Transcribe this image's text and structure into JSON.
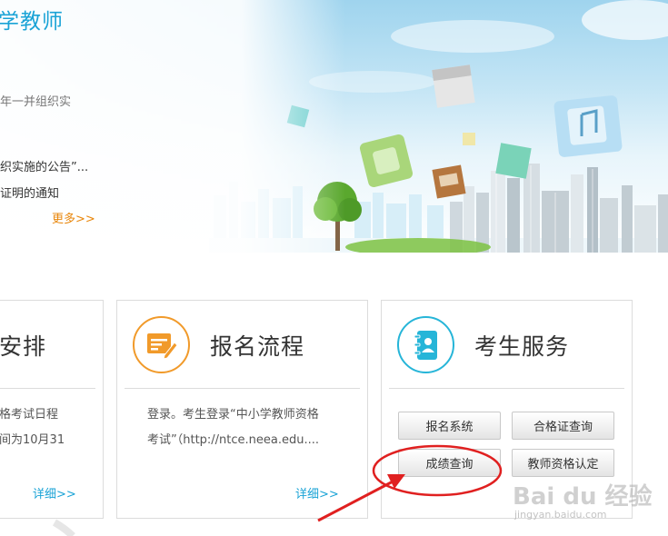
{
  "banner": {
    "title": "学教师",
    "lines": [
      "年一并组织实",
      "织实施的公告”...",
      "证明的通知"
    ],
    "more_label": "更多>>"
  },
  "cards": [
    {
      "title": "安排",
      "lines": [
        "格考试日程",
        "间为10月31"
      ],
      "more_label": "详细>>"
    },
    {
      "title": "报名流程",
      "lines": [
        "登录。考生登录“中小学教师资格",
        "考试”（http://ntce.neea.edu...."
      ],
      "more_label": "详细>>"
    },
    {
      "title": "考生服务",
      "buttons": [
        "报名系统",
        "合格证查询",
        "成绩查询",
        "教师资格认定"
      ]
    }
  ],
  "watermark": {
    "main": "Bai  du 经验",
    "sub": "jingyan.baidu.com"
  },
  "colors": {
    "brand_blue": "#1aa3d6",
    "accent_orange": "#f19a2a",
    "teal": "#26b5d8",
    "annotation_red": "#e02020"
  }
}
